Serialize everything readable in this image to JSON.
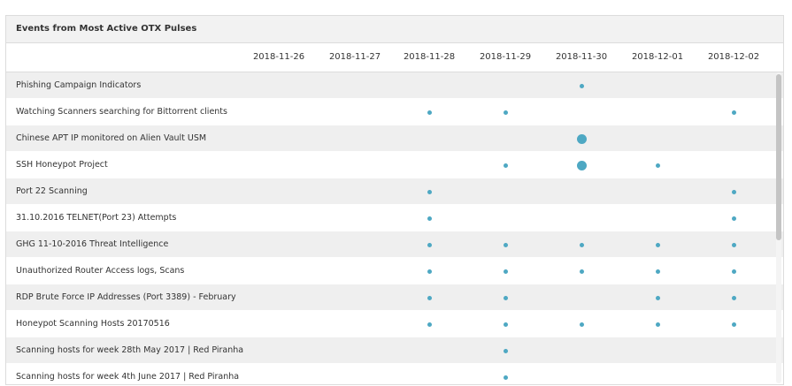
{
  "panel": {
    "title": "Events from Most Active OTX Pulses"
  },
  "chart_data": {
    "type": "scatter",
    "title": "Events from Most Active OTX Pulses",
    "columns": [
      "2018-11-26",
      "2018-11-27",
      "2018-11-28",
      "2018-11-29",
      "2018-11-30",
      "2018-12-01",
      "2018-12-02"
    ],
    "rows": [
      {
        "label": "Phishing Campaign Indicators",
        "events": [
          0,
          0,
          0,
          0,
          1,
          0,
          0
        ]
      },
      {
        "label": "Watching Scanners searching for Bittorrent clients",
        "events": [
          0,
          0,
          1,
          1,
          0,
          0,
          1
        ]
      },
      {
        "label": "Chinese APT IP monitored on Alien Vault USM",
        "events": [
          0,
          0,
          0,
          0,
          3,
          0,
          0
        ]
      },
      {
        "label": "SSH Honeypot Project",
        "events": [
          0,
          0,
          0,
          1,
          3,
          1,
          0
        ]
      },
      {
        "label": "Port 22 Scanning",
        "events": [
          0,
          0,
          1,
          0,
          0,
          0,
          1
        ]
      },
      {
        "label": "31.10.2016 TELNET(Port 23) Attempts",
        "events": [
          0,
          0,
          1,
          0,
          0,
          0,
          1
        ]
      },
      {
        "label": "GHG 11-10-2016 Threat Intelligence",
        "events": [
          0,
          0,
          1,
          1,
          1,
          1,
          1
        ]
      },
      {
        "label": "Unauthorized Router Access logs, Scans",
        "events": [
          0,
          0,
          1,
          1,
          1,
          1,
          1
        ]
      },
      {
        "label": "RDP Brute Force IP Addresses (Port 3389) - February",
        "events": [
          0,
          0,
          1,
          1,
          0,
          1,
          1
        ]
      },
      {
        "label": "Honeypot Scanning Hosts 20170516",
        "events": [
          0,
          0,
          1,
          1,
          1,
          1,
          1
        ]
      },
      {
        "label": "Scanning hosts for week 28th May 2017 | Red Piranha",
        "events": [
          0,
          0,
          0,
          1,
          0,
          0,
          0
        ]
      },
      {
        "label": "Scanning hosts for week 4th June 2017 | Red Piranha",
        "events": [
          0,
          0,
          0,
          1,
          0,
          0,
          0
        ]
      }
    ],
    "dot_color": "#4ea8c3",
    "row_stripe": "alternating"
  },
  "colors": {
    "dot": "#4ea8c3",
    "row_alt": "#efefef",
    "header_bg": "#f2f2f2",
    "border": "#dcdcdc"
  }
}
